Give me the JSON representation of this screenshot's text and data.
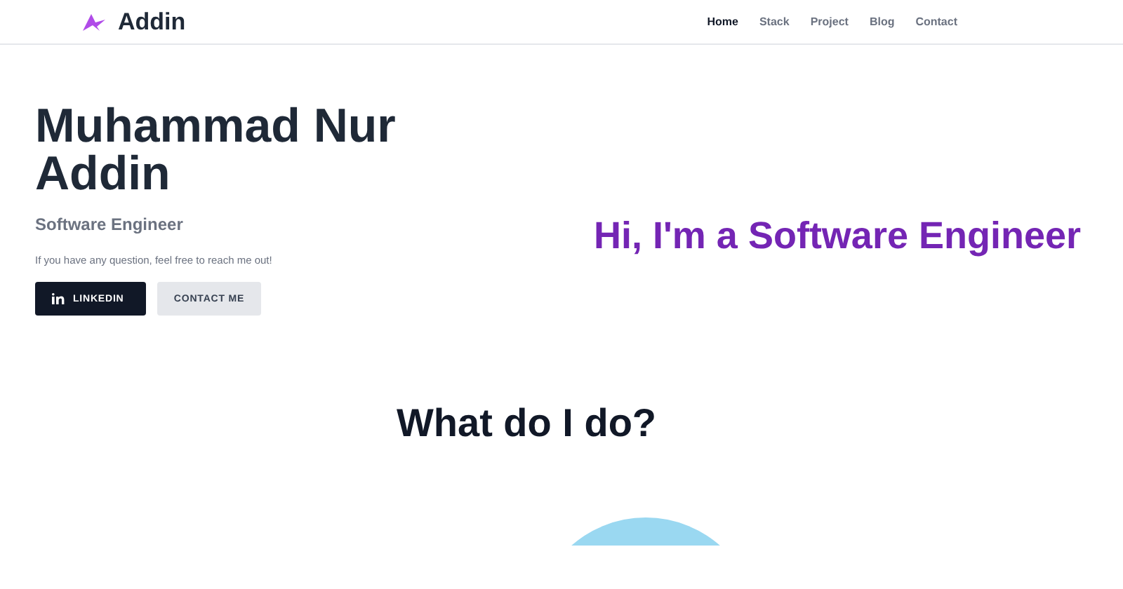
{
  "header": {
    "brand": "Addin",
    "nav": [
      {
        "label": "Home",
        "selected": true
      },
      {
        "label": "Stack",
        "selected": false
      },
      {
        "label": "Project",
        "selected": false
      },
      {
        "label": "Blog",
        "selected": false
      },
      {
        "label": "Contact",
        "selected": false
      }
    ]
  },
  "hero": {
    "name": "Muhammad Nur Addin",
    "role": "Software Engineer",
    "message": "If you have any question, feel free to reach me out!",
    "buttons": [
      {
        "label": "LINKEDIN",
        "kind": "primary"
      },
      {
        "label": "CONTACT ME",
        "kind": "secondary"
      }
    ],
    "tagline": "Hi, I'm a Software Engineer"
  },
  "services": {
    "heading": "What do I do?"
  }
}
